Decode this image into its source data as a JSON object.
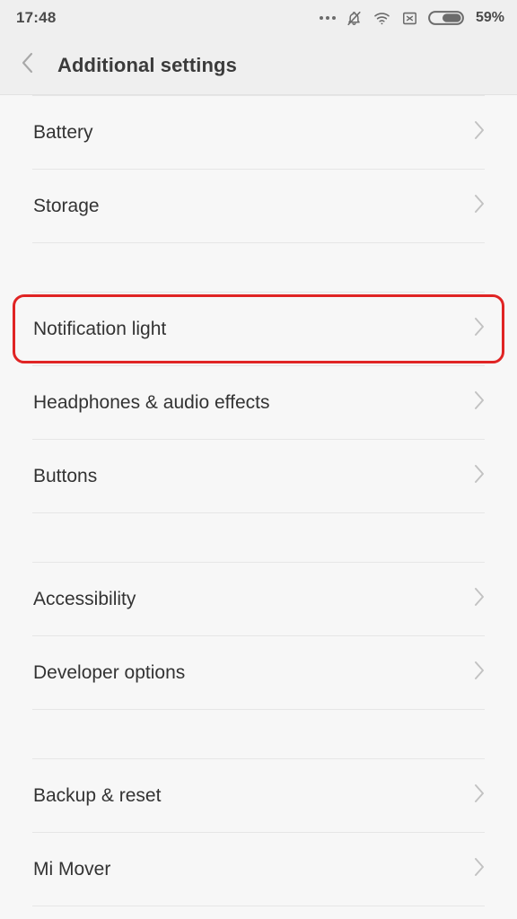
{
  "status_bar": {
    "time": "17:48",
    "battery_percent": "59%",
    "battery_level": 59,
    "icons": [
      {
        "name": "more-dots-icon",
        "label": "..."
      },
      {
        "name": "bell-muted-icon",
        "label": "silent"
      },
      {
        "name": "wifi-icon",
        "label": "wifi"
      },
      {
        "name": "no-sim-icon",
        "label": "no sim"
      },
      {
        "name": "battery-icon",
        "label": "battery"
      }
    ]
  },
  "header": {
    "title": "Additional settings",
    "back_icon": "chevron-left-icon"
  },
  "list": {
    "chevron_icon": "chevron-right-icon",
    "groups": [
      {
        "items": [
          {
            "label": "Battery",
            "highlighted": false
          },
          {
            "label": "Storage",
            "highlighted": false
          }
        ]
      },
      {
        "items": [
          {
            "label": "Notification light",
            "highlighted": true
          },
          {
            "label": "Headphones & audio effects",
            "highlighted": false
          },
          {
            "label": "Buttons",
            "highlighted": false
          }
        ]
      },
      {
        "items": [
          {
            "label": "Accessibility",
            "highlighted": false
          },
          {
            "label": "Developer options",
            "highlighted": false
          }
        ]
      },
      {
        "items": [
          {
            "label": "Backup & reset",
            "highlighted": false
          },
          {
            "label": "Mi Mover",
            "highlighted": false
          }
        ]
      }
    ]
  },
  "colors": {
    "highlight": "#e02424",
    "background": "#f7f7f7",
    "header_background": "#efefef",
    "text": "#333333",
    "divider": "#e6e6e6"
  }
}
